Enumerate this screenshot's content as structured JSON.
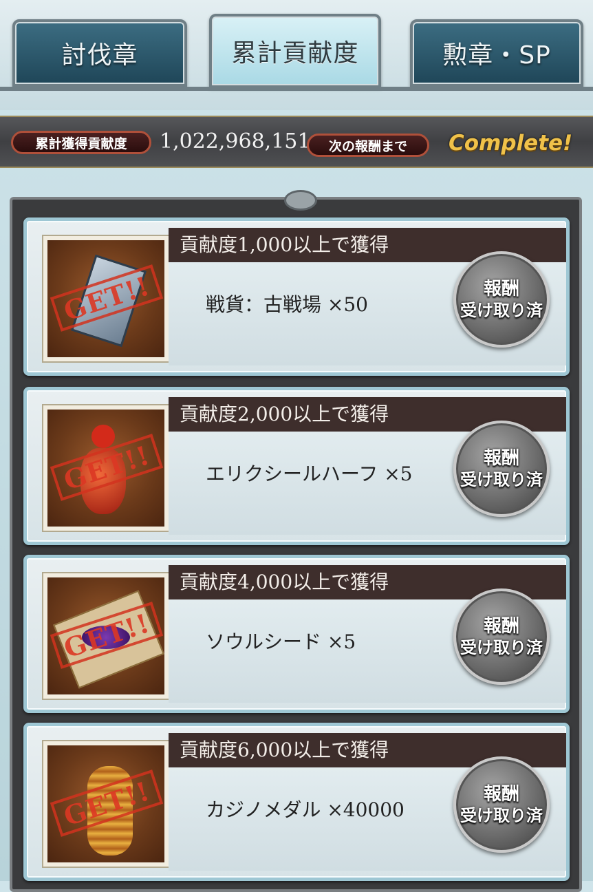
{
  "tabs": [
    {
      "label": "討伐章",
      "active": false
    },
    {
      "label": "累計貢献度",
      "active": true
    },
    {
      "label": "勲章・SP",
      "active": false
    }
  ],
  "contribution": {
    "total_label": "累計獲得貢献度",
    "total_value": "1,022,968,151",
    "next_label": "次の報酬まで",
    "status": "Complete!"
  },
  "rewards": [
    {
      "header": "貢献度1,000以上で獲得",
      "item": "戦貨：古戦場 ×50",
      "icon": "war-coin-icon",
      "stamp": "GET!!",
      "button_line1": "報酬",
      "button_line2": "受け取り済"
    },
    {
      "header": "貢献度2,000以上で獲得",
      "item": "エリクシールハーフ ×5",
      "icon": "elixir-half-icon",
      "stamp": "GET!!",
      "button_line1": "報酬",
      "button_line2": "受け取り済"
    },
    {
      "header": "貢献度4,000以上で獲得",
      "item": "ソウルシード ×5",
      "icon": "soul-seed-icon",
      "stamp": "GET!!",
      "button_line1": "報酬",
      "button_line2": "受け取り済"
    },
    {
      "header": "貢献度6,000以上で獲得",
      "item": "カジノメダル ×40000",
      "icon": "casino-medal-icon",
      "stamp": "GET!!",
      "button_line1": "報酬",
      "button_line2": "受け取り済"
    }
  ]
}
